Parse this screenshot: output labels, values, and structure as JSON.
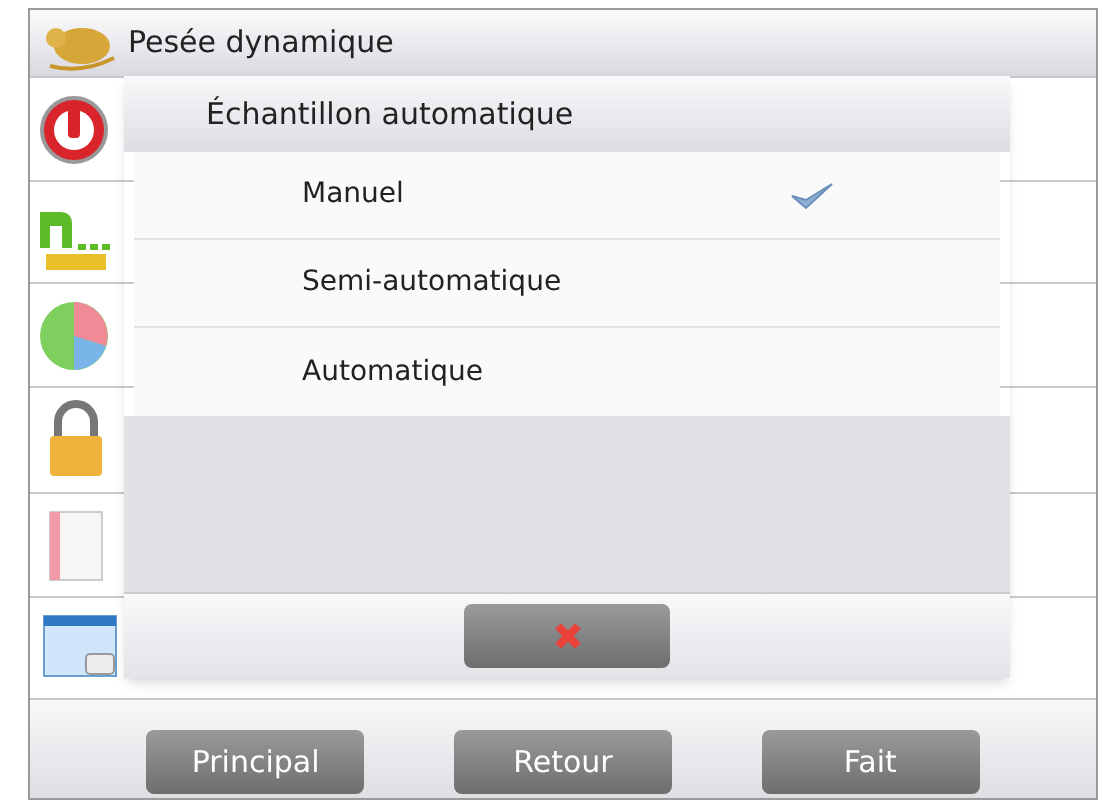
{
  "header": {
    "title": "Pesée dynamique"
  },
  "dialog": {
    "title": "Échantillon automatique",
    "options": [
      {
        "label": "Manuel",
        "selected": true
      },
      {
        "label": "Semi-automatique",
        "selected": false
      },
      {
        "label": "Automatique",
        "selected": false
      }
    ]
  },
  "footer_buttons": [
    "Principal",
    "Retour",
    "Fait"
  ]
}
